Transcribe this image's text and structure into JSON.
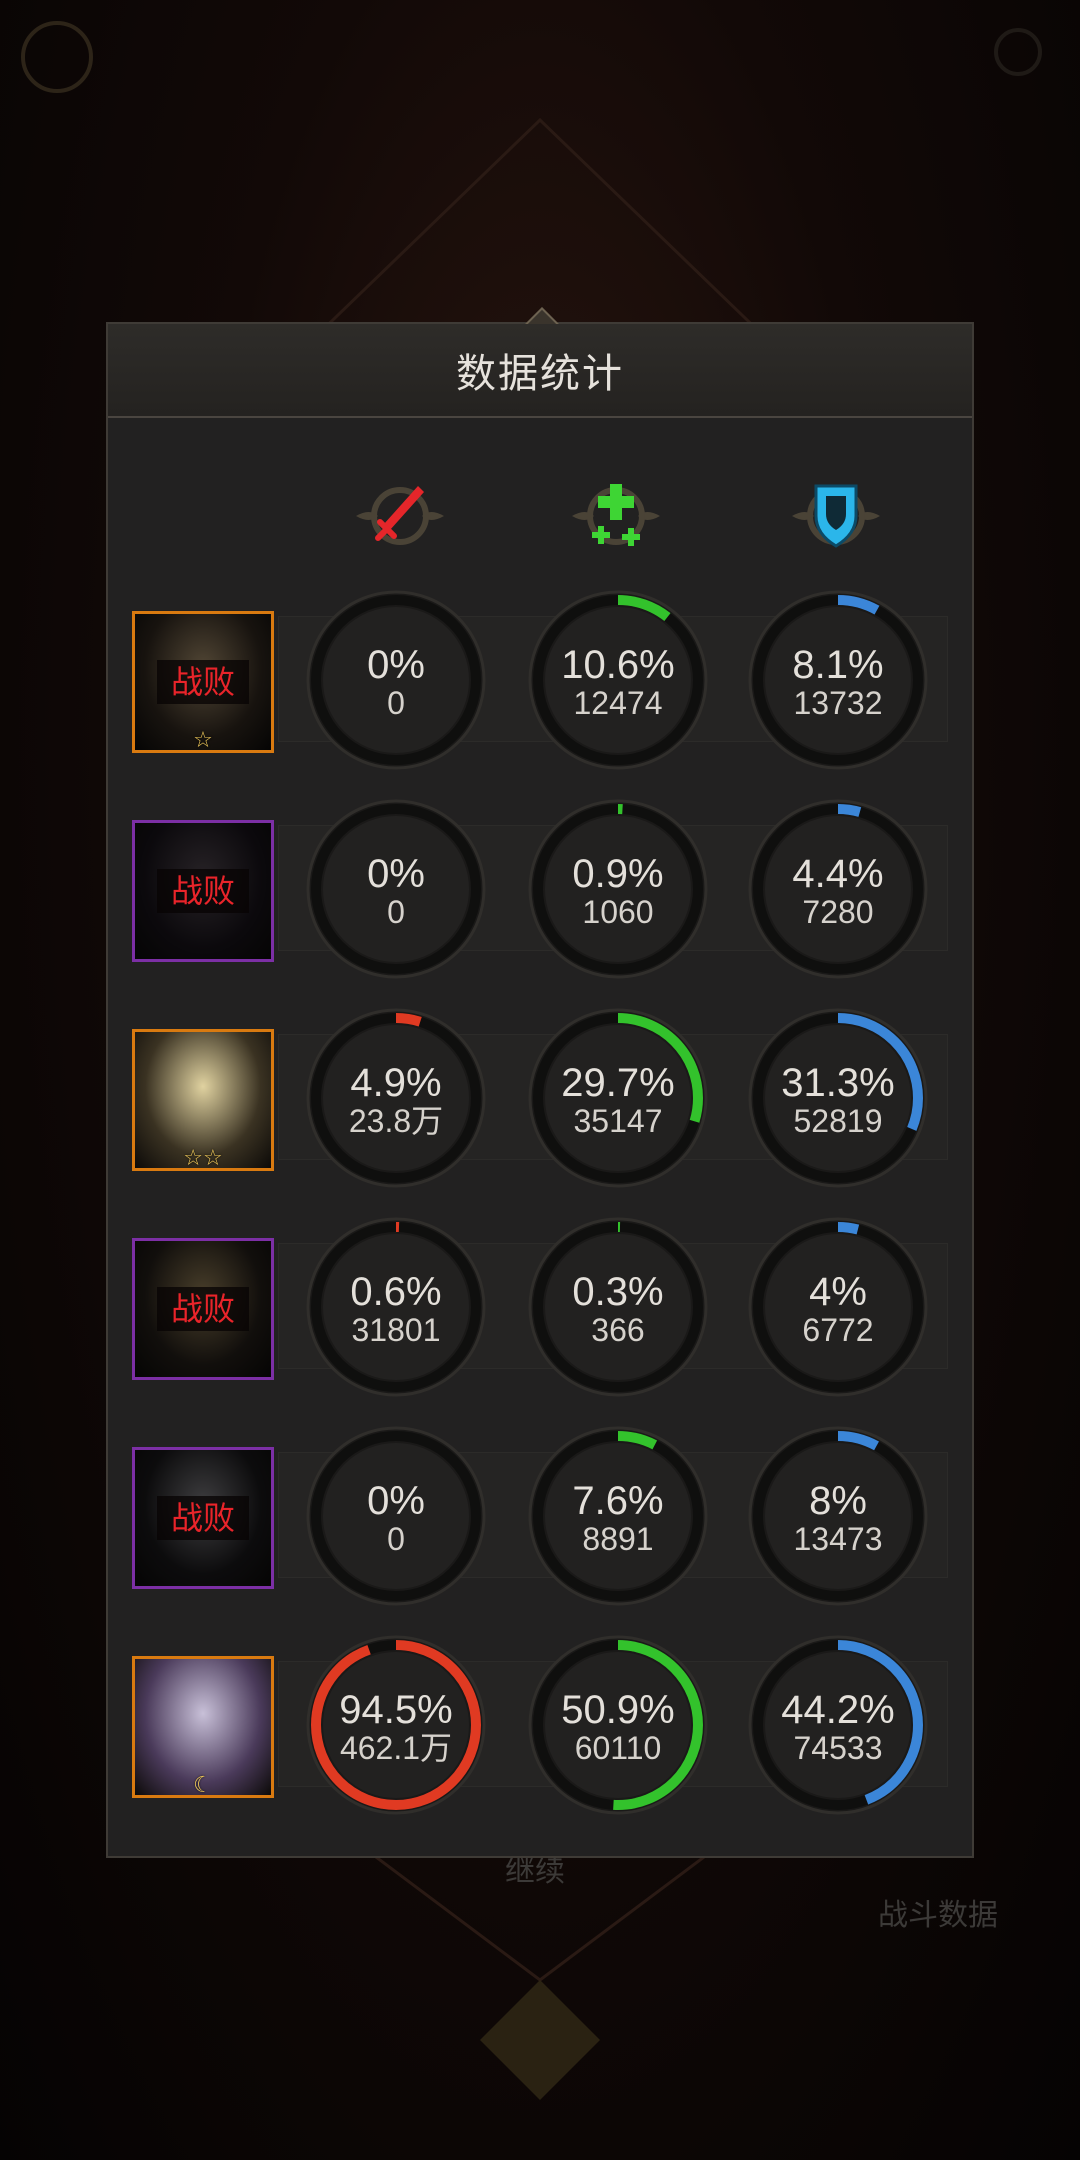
{
  "panel": {
    "title": "数据统计"
  },
  "background": {
    "continue_label": "继续",
    "battle_data_label": "战斗数据"
  },
  "columns": [
    {
      "name": "damage",
      "icon": "sword-icon",
      "color": "#e03a22"
    },
    {
      "name": "healing",
      "icon": "heal-cross-icon",
      "color": "#33c22c"
    },
    {
      "name": "damage-taken",
      "icon": "shield-icon",
      "color": "#3b86d8"
    }
  ],
  "rows": [
    {
      "defeated": true,
      "status_label": "战败",
      "frame": "orange",
      "stars": "☆",
      "stats": [
        {
          "pct_text": "0%",
          "value": "0",
          "fill": 0.0
        },
        {
          "pct_text": "10.6%",
          "value": "12474",
          "fill": 0.106
        },
        {
          "pct_text": "8.1%",
          "value": "13732",
          "fill": 0.081
        }
      ]
    },
    {
      "defeated": true,
      "status_label": "战败",
      "frame": "purple",
      "stars": "",
      "stats": [
        {
          "pct_text": "0%",
          "value": "0",
          "fill": 0.0
        },
        {
          "pct_text": "0.9%",
          "value": "1060",
          "fill": 0.009
        },
        {
          "pct_text": "4.4%",
          "value": "7280",
          "fill": 0.044
        }
      ]
    },
    {
      "defeated": false,
      "status_label": "",
      "frame": "orange",
      "stars": "☆☆",
      "stats": [
        {
          "pct_text": "4.9%",
          "value": "23.8万",
          "fill": 0.049
        },
        {
          "pct_text": "29.7%",
          "value": "35147",
          "fill": 0.297
        },
        {
          "pct_text": "31.3%",
          "value": "52819",
          "fill": 0.313
        }
      ]
    },
    {
      "defeated": true,
      "status_label": "战败",
      "frame": "purple",
      "stars": "",
      "stats": [
        {
          "pct_text": "0.6%",
          "value": "31801",
          "fill": 0.006
        },
        {
          "pct_text": "0.3%",
          "value": "366",
          "fill": 0.003
        },
        {
          "pct_text": "4%",
          "value": "6772",
          "fill": 0.04
        }
      ]
    },
    {
      "defeated": true,
      "status_label": "战败",
      "frame": "purple",
      "stars": "",
      "stats": [
        {
          "pct_text": "0%",
          "value": "0",
          "fill": 0.0
        },
        {
          "pct_text": "7.6%",
          "value": "8891",
          "fill": 0.076
        },
        {
          "pct_text": "8%",
          "value": "13473",
          "fill": 0.08
        }
      ]
    },
    {
      "defeated": false,
      "status_label": "",
      "frame": "orange",
      "stars": "☾",
      "stats": [
        {
          "pct_text": "94.5%",
          "value": "462.1万",
          "fill": 0.945
        },
        {
          "pct_text": "50.9%",
          "value": "60110",
          "fill": 0.509
        },
        {
          "pct_text": "44.2%",
          "value": "74533",
          "fill": 0.442
        }
      ]
    }
  ]
}
